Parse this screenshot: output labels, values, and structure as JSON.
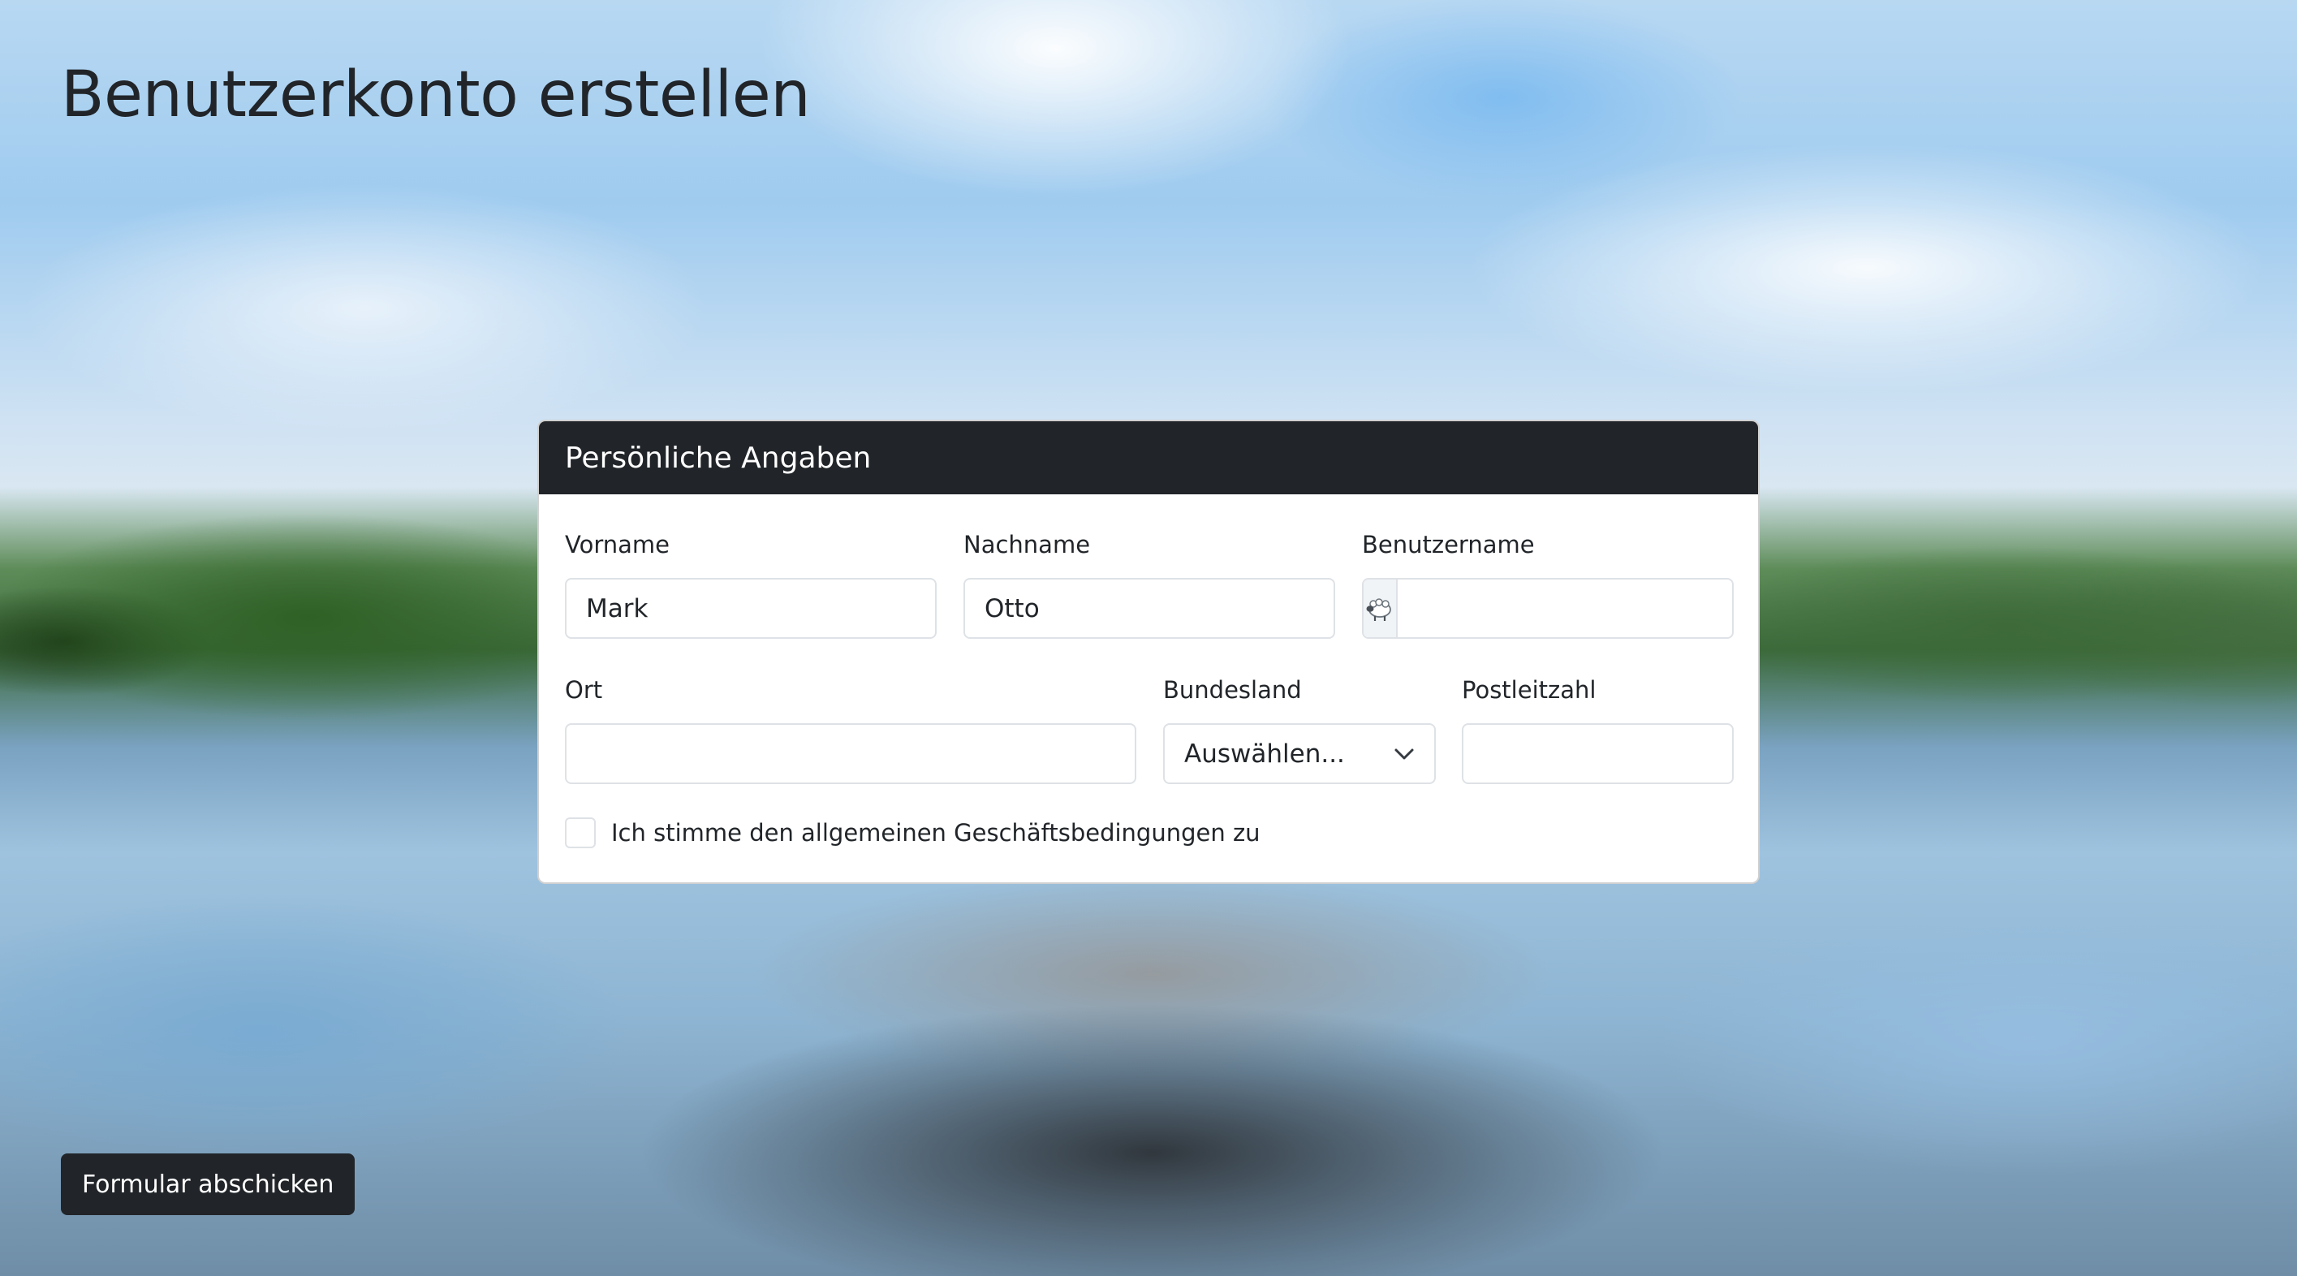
{
  "page": {
    "title": "Benutzerkonto erstellen"
  },
  "card": {
    "header": "Persönliche Angaben"
  },
  "form": {
    "vorname": {
      "label": "Vorname",
      "value": "Mark"
    },
    "nachname": {
      "label": "Nachname",
      "value": "Otto"
    },
    "benutzername": {
      "label": "Benutzername",
      "value": "",
      "prefix_icon": "sheep-icon"
    },
    "ort": {
      "label": "Ort",
      "value": ""
    },
    "bundesland": {
      "label": "Bundesland",
      "selected": "Auswählen..."
    },
    "postleitzahl": {
      "label": "Postleitzahl",
      "value": ""
    },
    "agb": {
      "label": "Ich stimme den allgemeinen Geschäftsbedingungen zu",
      "checked": false
    }
  },
  "submit": {
    "label": "Formular abschicken"
  },
  "colors": {
    "dark": "#212529",
    "border": "#dee2e6",
    "addon_bg": "#f1f4f7"
  }
}
